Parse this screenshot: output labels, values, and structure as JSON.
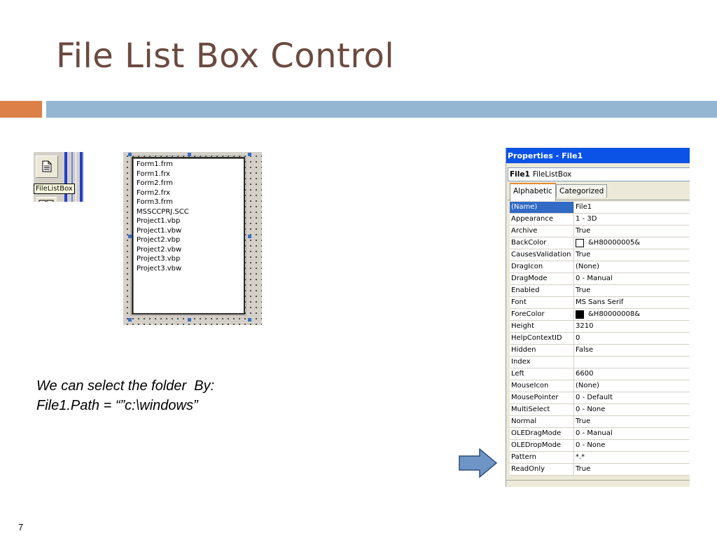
{
  "slide": {
    "title": "File List Box Control",
    "page_number": "7",
    "colors": {
      "title": "#6b4a3f",
      "accent_orange": "#dd8047",
      "accent_blue": "#94b6d2"
    }
  },
  "toolbox": {
    "tooltip": "FileListBox",
    "icon": "filelistbox-icon"
  },
  "file_list": {
    "items": [
      "Form1.frm",
      "Form1.frx",
      "Form2.frm",
      "Form2.frx",
      "Form3.frm",
      "MSSCCPRJ.SCC",
      "Project1.vbp",
      "Project1.vbw",
      "Project2.vbp",
      "Project2.vbw",
      "Project3.vbp",
      "Project3.vbw"
    ]
  },
  "caption": {
    "line1": "We can select the folder  By:",
    "line2": "File1.Path = “”c:\\windows”"
  },
  "properties": {
    "title": "Properties - File1",
    "object_name": "File1",
    "object_type": "FileListBox",
    "tabs": [
      "Alphabetic",
      "Categorized"
    ],
    "active_tab": "Alphabetic",
    "rows": [
      {
        "name": "(Name)",
        "value": "File1",
        "selected": true
      },
      {
        "name": "Appearance",
        "value": "1 - 3D"
      },
      {
        "name": "Archive",
        "value": "True"
      },
      {
        "name": "BackColor",
        "value": "&H80000005&",
        "swatch": "#ffffff"
      },
      {
        "name": "CausesValidation",
        "value": "True"
      },
      {
        "name": "DragIcon",
        "value": "(None)"
      },
      {
        "name": "DragMode",
        "value": "0 - Manual"
      },
      {
        "name": "Enabled",
        "value": "True"
      },
      {
        "name": "Font",
        "value": "MS Sans Serif"
      },
      {
        "name": "ForeColor",
        "value": "&H80000008&",
        "swatch": "#000000"
      },
      {
        "name": "Height",
        "value": "3210"
      },
      {
        "name": "HelpContextID",
        "value": "0"
      },
      {
        "name": "Hidden",
        "value": "False"
      },
      {
        "name": "Index",
        "value": ""
      },
      {
        "name": "Left",
        "value": "6600"
      },
      {
        "name": "MouseIcon",
        "value": "(None)"
      },
      {
        "name": "MousePointer",
        "value": "0 - Default"
      },
      {
        "name": "MultiSelect",
        "value": "0 - None"
      },
      {
        "name": "Normal",
        "value": "True"
      },
      {
        "name": "OLEDragMode",
        "value": "0 - Manual"
      },
      {
        "name": "OLEDropMode",
        "value": "0 - None"
      },
      {
        "name": "Pattern",
        "value": "*.*"
      },
      {
        "name": "ReadOnly",
        "value": "True"
      }
    ]
  },
  "arrow": {
    "icon": "right-arrow-icon",
    "color": "#6f94c6"
  }
}
